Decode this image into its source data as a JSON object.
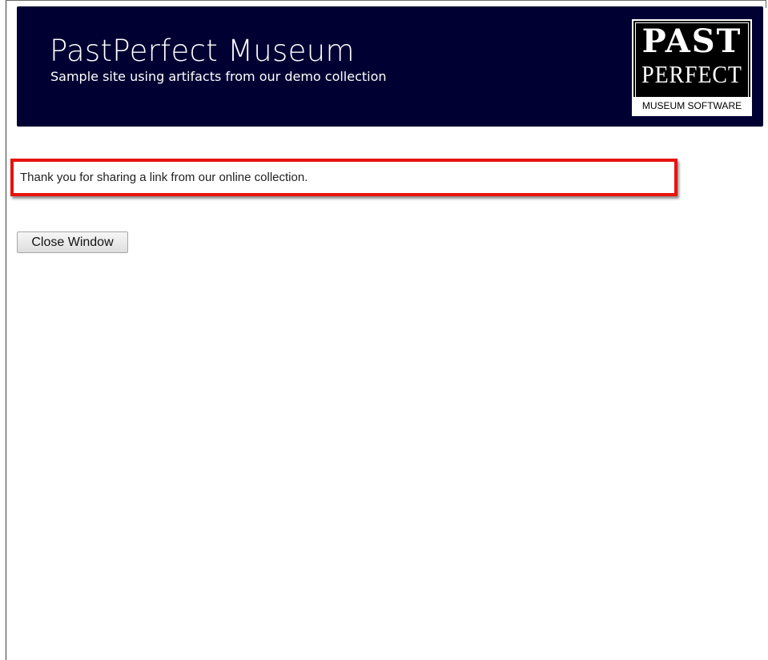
{
  "header": {
    "title": "PastPerfect Museum",
    "subtitle": "Sample site using artifacts from our demo collection",
    "background_color": "#000033",
    "logo": {
      "line1": "PAST",
      "line2": "PERFECT",
      "line3": "MUSEUM SOFTWARE"
    }
  },
  "message": {
    "text": "Thank you for sharing a link from our online collection.",
    "highlight_color": "#e8130e"
  },
  "actions": {
    "close_label": "Close Window"
  }
}
